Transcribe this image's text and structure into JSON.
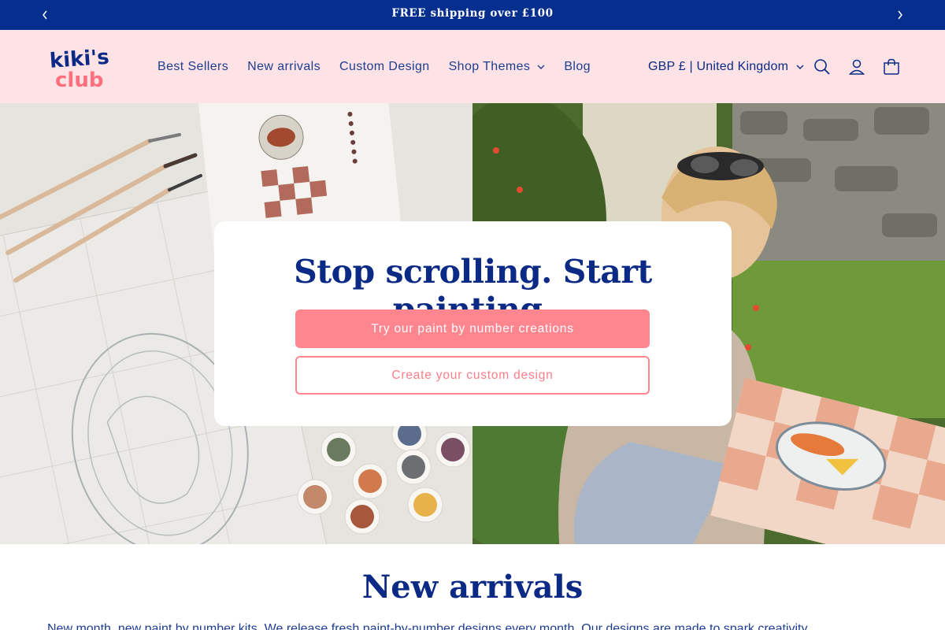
{
  "announcement": {
    "text": "FREE shipping over £100",
    "prev_icon": "chevron-left-icon",
    "next_icon": "chevron-right-icon"
  },
  "header": {
    "logo_text": "kiki's club",
    "nav": [
      {
        "label": "Best Sellers"
      },
      {
        "label": "New arrivals"
      },
      {
        "label": "Custom Design"
      },
      {
        "label": "Shop Themes",
        "has_dropdown": true
      },
      {
        "label": "Blog"
      }
    ],
    "currency": "GBP £ | United Kingdom",
    "icons": [
      "search-icon",
      "account-icon",
      "cart-icon"
    ],
    "colors": {
      "background": "#fde3e6",
      "nav_text": "#1f3d8f"
    }
  },
  "hero": {
    "title": "Stop scrolling. Start painting.",
    "primary_button": "Try our paint by number creations",
    "secondary_button": "Create your custom design",
    "colors": {
      "accent": "#ff858f",
      "title": "#0b2a85"
    }
  },
  "new_arrivals": {
    "title": "New arrivals",
    "subtitle": "New month, new paint by number kits. We release fresh paint-by-number designs every month. Our designs are made to spark creativity."
  },
  "colors": {
    "brand_blue": "#052f8f",
    "brand_pink": "#ff858f"
  }
}
